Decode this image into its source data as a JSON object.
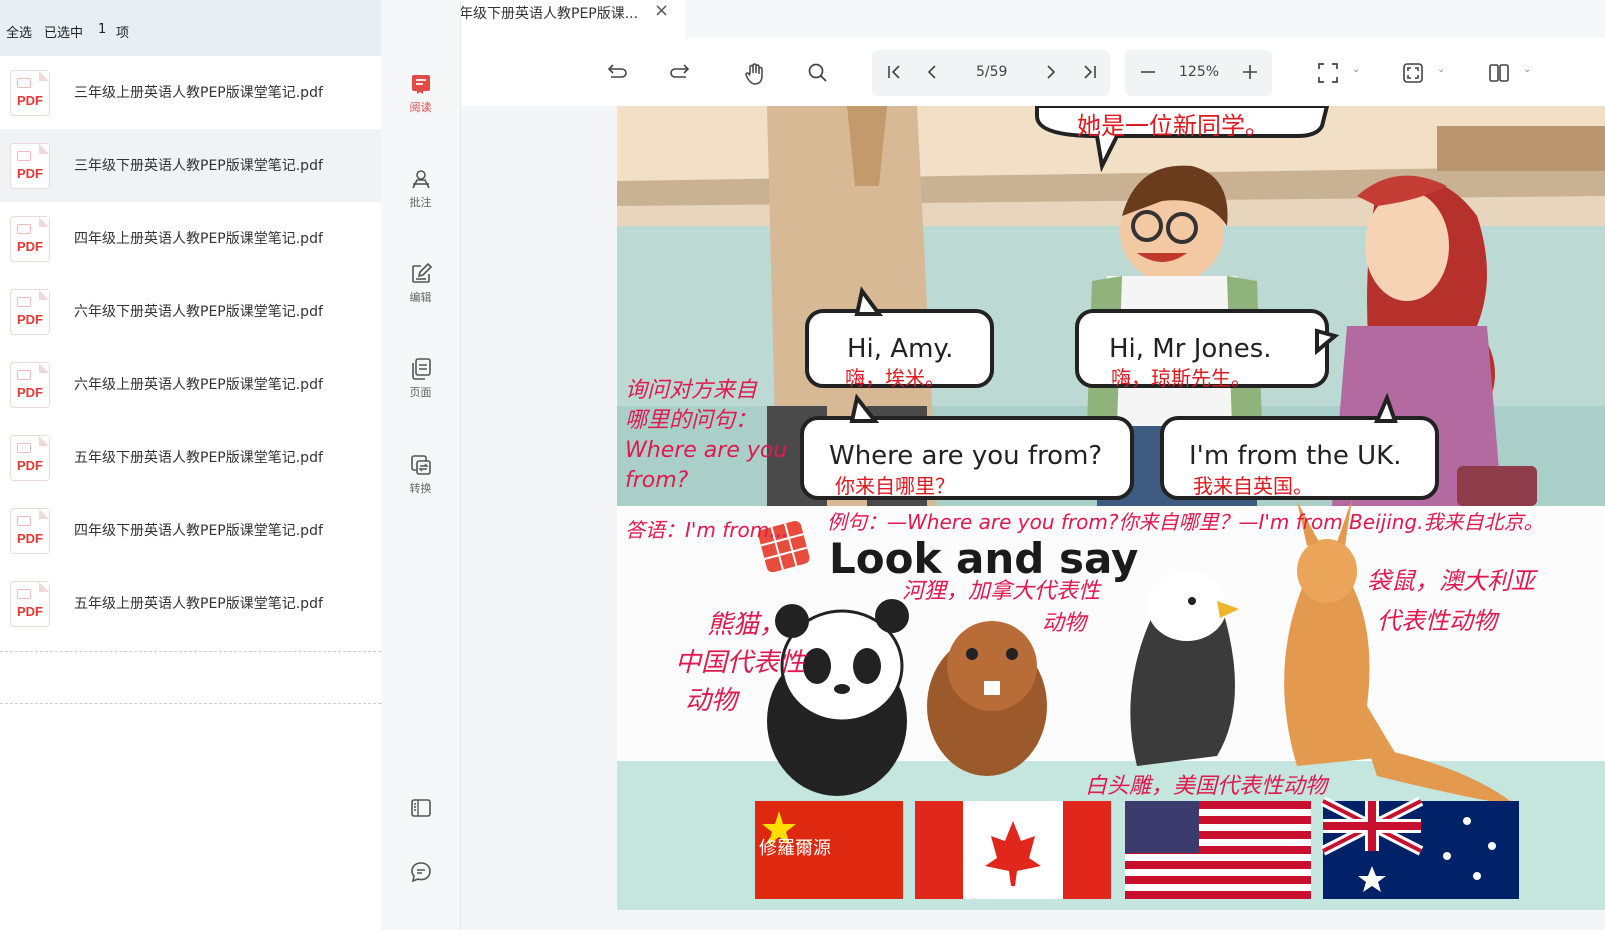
{
  "selection": {
    "select_all": "全选",
    "selected": "已选中",
    "count": "1",
    "unit": "项"
  },
  "files": [
    {
      "name": "三年级上册英语人教PEP版课堂笔记.pdf",
      "selected": false
    },
    {
      "name": "三年级下册英语人教PEP版课堂笔记.pdf",
      "selected": true
    },
    {
      "name": "四年级上册英语人教PEP版课堂笔记.pdf",
      "selected": false
    },
    {
      "name": "六年级下册英语人教PEP版课堂笔记.pdf",
      "selected": false
    },
    {
      "name": "六年级上册英语人教PEP版课堂笔记.pdf",
      "selected": false
    },
    {
      "name": "五年级下册英语人教PEP版课堂笔记.pdf",
      "selected": false
    },
    {
      "name": "四年级下册英语人教PEP版课堂笔记.pdf",
      "selected": false
    },
    {
      "name": "五年级上册英语人教PEP版课堂笔记.pdf",
      "selected": false
    }
  ],
  "file_icon_label": "PDF",
  "nav": [
    {
      "label": "阅读",
      "icon": "book-icon",
      "active": true
    },
    {
      "label": "批注",
      "icon": "annotate-icon",
      "active": false
    },
    {
      "label": "编辑",
      "icon": "edit-icon",
      "active": false
    },
    {
      "label": "页面",
      "icon": "pages-icon",
      "active": false
    },
    {
      "label": "转换",
      "icon": "convert-icon",
      "active": false
    }
  ],
  "tab": {
    "title": "三年级下册英语人教PEP版课...",
    "close": "×"
  },
  "toolbar": {
    "page": "5/59",
    "zoom": "125%"
  },
  "document": {
    "bubbles": [
      {
        "en": "Hi, Amy.",
        "zh": "嗨，埃米。"
      },
      {
        "en": "Hi, Mr Jones.",
        "zh": "嗨，琼斯先生。"
      },
      {
        "en": "Where are you from?",
        "zh": "你来自哪里？"
      },
      {
        "en": "I'm from the UK.",
        "zh": "我来自英国。"
      }
    ],
    "top_note": "她是一位新同学。",
    "left_note_1": "询问对方来自",
    "left_note_2": "哪里的问句：",
    "left_note_3": "Where are you",
    "left_note_4": "from?",
    "answer_note": "答语：I'm from...",
    "example_note": "例句：—Where are you from?你来自哪里？—I'm from Beijing.我来自北京。",
    "section_title": "Look and say",
    "panda_note_1": "熊猫，",
    "panda_note_2": "中国代表性",
    "panda_note_3": "动物",
    "beaver_note_1": "河狸，加拿大代表性",
    "beaver_note_2": "动物",
    "kangaroo_note_1": "袋鼠，澳大利亚",
    "kangaroo_note_2": "代表性动物",
    "eagle_note": "白头雕，美国代表性动物",
    "watermark_logo": "修羅爾源"
  }
}
